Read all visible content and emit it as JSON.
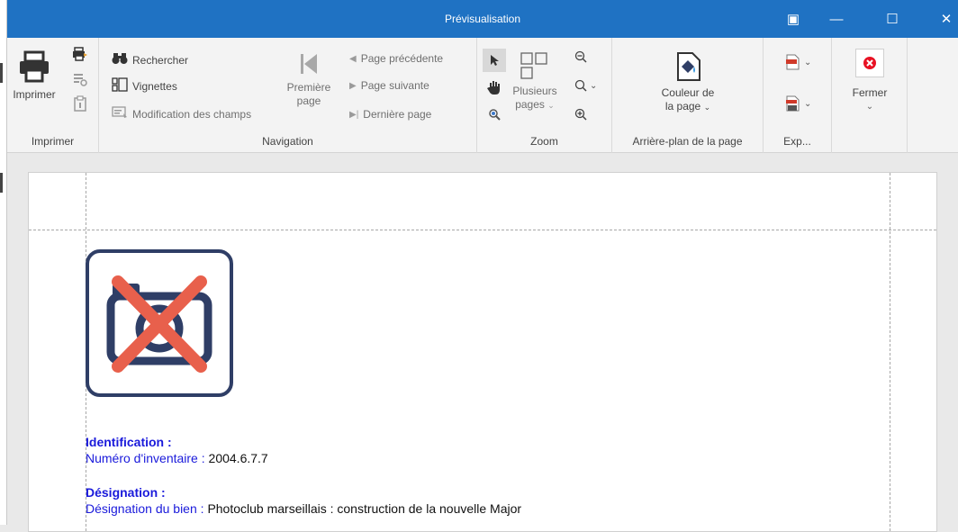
{
  "window": {
    "title": "Prévisualisation",
    "controls": {
      "restore": "▣",
      "minimize": "—",
      "maximize": "☐",
      "close": "✕"
    }
  },
  "ribbon": {
    "print_group": {
      "print_label": "Imprimer",
      "group_label": "Imprimer"
    },
    "navigation_group": {
      "search_label": "Rechercher",
      "thumbnails_label": "Vignettes",
      "edit_fields_label": "Modification des champs",
      "first_page_line1": "Première",
      "first_page_line2": "page",
      "previous_page_label": "Page précédente",
      "next_page_label": "Page suivante",
      "last_page_label": "Dernière page",
      "group_label": "Navigation"
    },
    "zoom_group": {
      "multi_pages_line1": "Plusieurs",
      "multi_pages_line2": "pages",
      "group_label": "Zoom"
    },
    "background_group": {
      "page_color_line1": "Couleur de",
      "page_color_line2": "la page",
      "group_label": "Arrière-plan de la page"
    },
    "export_group": {
      "group_label": "Exp..."
    },
    "close_group": {
      "close_label": "Fermer"
    }
  },
  "document": {
    "identification_heading": "Identification :",
    "inventory_label": "Numéro d'inventaire",
    "separator": " : ",
    "inventory_value": "2004.6.7.7",
    "designation_heading": "Désignation :",
    "designation_label": "Désignation du bien",
    "designation_value": "Photoclub marseillais : construction de la nouvelle Major"
  },
  "colors": {
    "titlebar": "#1f72c3",
    "heading_blue": "#1a1adb",
    "close_red": "#e81123",
    "placeholder_frame": "#2f3e66",
    "placeholder_cross": "#e8604c"
  }
}
